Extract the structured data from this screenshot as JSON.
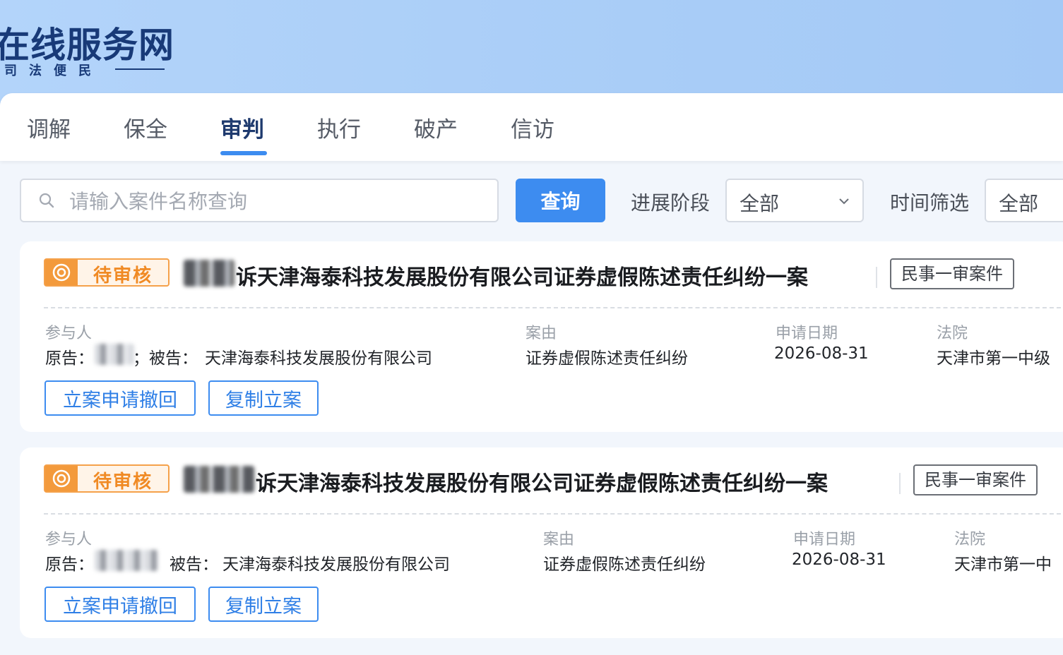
{
  "site": {
    "title": "在线服务网",
    "slogan": "司法便民"
  },
  "tabs": [
    {
      "label": "调解",
      "active": false
    },
    {
      "label": "保全",
      "active": false
    },
    {
      "label": "审判",
      "active": true
    },
    {
      "label": "执行",
      "active": false
    },
    {
      "label": "破产",
      "active": false
    },
    {
      "label": "信访",
      "active": false
    }
  ],
  "search": {
    "placeholder": "请输入案件名称查询",
    "button_label": "查询"
  },
  "filters": {
    "stage_label": "进展阶段",
    "stage_value": "全部",
    "time_label": "时间筛选",
    "time_value": "全部"
  },
  "cases": [
    {
      "status": "待审核",
      "title": "诉天津海泰科技发展股份有限公司证券虚假陈述责任纠纷一案",
      "case_type": "民事一审案件",
      "participants_label": "参与人",
      "plaintiff_label": "原告：",
      "defendant_label": "；被告：",
      "defendant": "天津海泰科技发展股份有限公司",
      "cause_label": "案由",
      "cause": "证券虚假陈述责任纠纷",
      "date_label": "申请日期",
      "date": "2026-08-31",
      "court_label": "法院",
      "court": "天津市第一中级",
      "actions": [
        "立案申请撤回",
        "复制立案"
      ]
    },
    {
      "status": "待审核",
      "title": "诉天津海泰科技发展股份有限公司证券虚假陈述责任纠纷一案",
      "case_type": "民事一审案件",
      "participants_label": "参与人",
      "plaintiff_label": "原告：",
      "defendant_label": "被告：",
      "defendant": "天津海泰科技发展股份有限公司",
      "cause_label": "案由",
      "cause": "证券虚假陈述责任纠纷",
      "date_label": "申请日期",
      "date": "2026-08-31",
      "court_label": "法院",
      "court": "天津市第一中",
      "actions": [
        "立案申请撤回",
        "复制立案"
      ]
    }
  ],
  "colors": {
    "accent": "#3d8cf0",
    "status_orange": "#f39a3c",
    "banner": "#a9cdf7"
  }
}
